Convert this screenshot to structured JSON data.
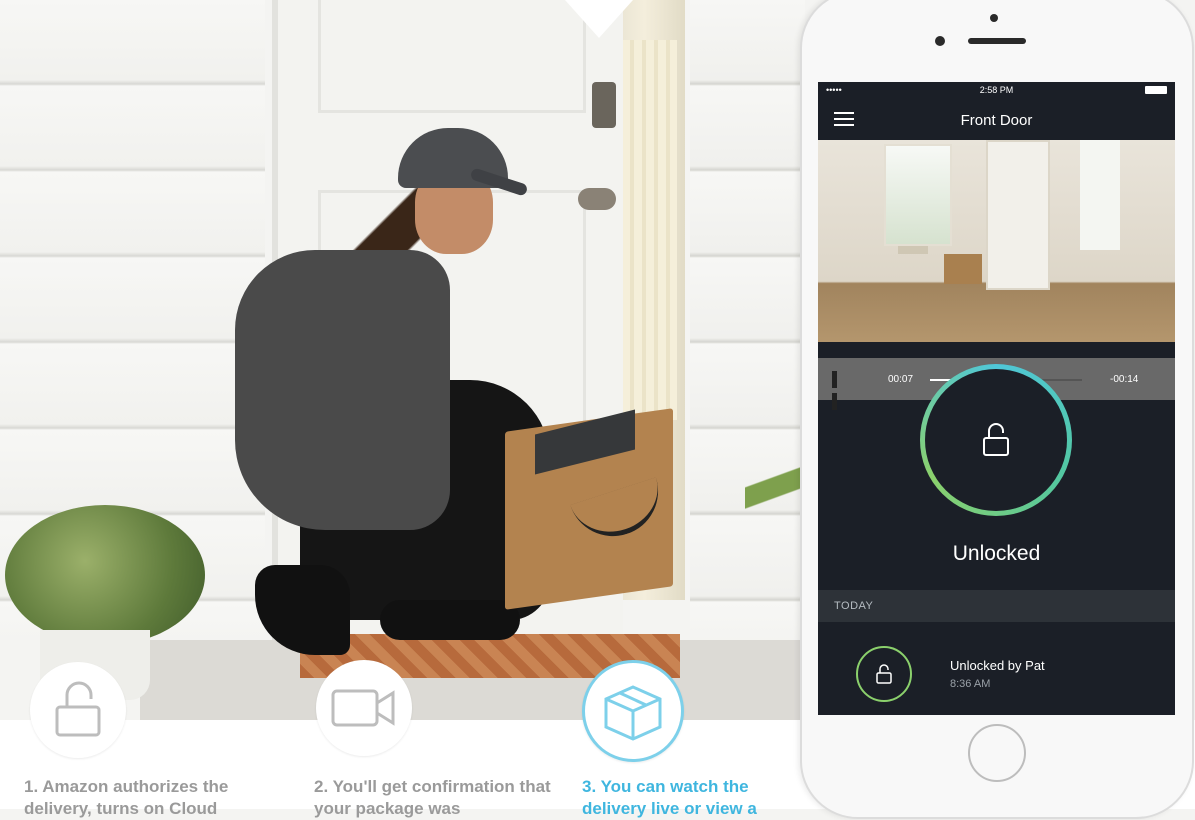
{
  "steps": [
    {
      "text": "1. Amazon authorizes the delivery, turns on Cloud",
      "icon": "unlocked-padlock-icon",
      "active": false
    },
    {
      "text": "2. You'll get confirmation that your package was",
      "icon": "video-camera-icon",
      "active": false
    },
    {
      "text": "3. You can watch the delivery live or view a",
      "icon": "package-box-icon",
      "active": true
    }
  ],
  "phone": {
    "status_bar": {
      "signal": "••••• ",
      "time": "2:58 PM"
    },
    "title": "Front Door",
    "video": {
      "elapsed": "00:07",
      "remaining": "-00:14",
      "progress": 0.34
    },
    "lock_status": "Unlocked",
    "section_label": "TODAY",
    "activity": {
      "title": "Unlocked by Pat",
      "time": "8:36 AM"
    }
  },
  "colors": {
    "accent": "#3fb6df",
    "ring_green": "#8bd06c",
    "ring_teal": "#4fc7d9",
    "screen_bg": "#1b1f27"
  }
}
